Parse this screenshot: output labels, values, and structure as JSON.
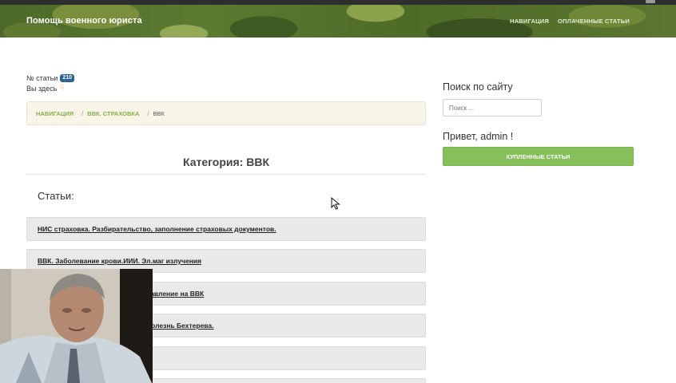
{
  "navbar": {
    "brand": "Помощь военного юриста",
    "links": [
      "НАВИГАЦИЯ",
      "ОПЛАЧЕННЫЕ СТАТЬИ"
    ]
  },
  "meta": {
    "article_no_label": "№ статьи",
    "article_no": "210",
    "you_are_here": "Вы здесь"
  },
  "breadcrumb": {
    "items": [
      "НАВИГАЦИЯ",
      "ВВК. СТРАХОВКА"
    ],
    "separator": "/",
    "current": "ВВК"
  },
  "main": {
    "category_title": "Категория: ВВК",
    "articles_heading": "Статьи:",
    "articles": [
      "НИС страховка. Разбирательство, заполнение страховых документов.",
      "ВВК. Заболевание крови.ИИИ. Эл.маг излучения",
      "равление на ВВК",
      "Болезнь Бехтерева.",
      "",
      ""
    ]
  },
  "sidebar": {
    "search_title": "Поиск по сайту",
    "search_placeholder": "Поиск ...",
    "greeting": "Привет, admin !",
    "bought_button": "КУПЛЕННЫЕ СТАТЬИ"
  },
  "colors": {
    "accent_green": "#86c05a",
    "breadcrumb_link": "#8ab04a",
    "badge_blue": "#2a6496",
    "navbar_camo": "#4e6b28"
  },
  "icons": [
    "pointing-hand-icon",
    "mouse-cursor-icon"
  ]
}
